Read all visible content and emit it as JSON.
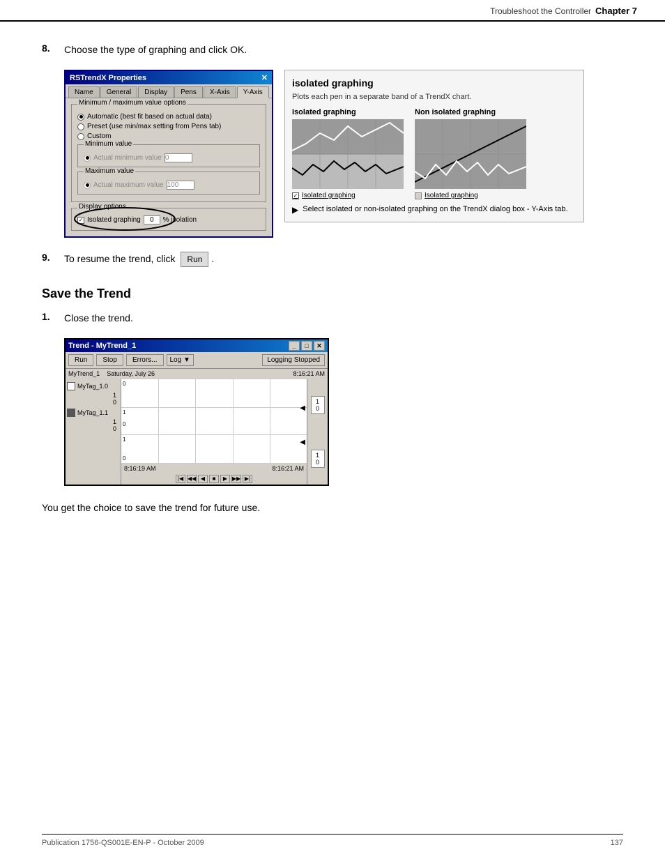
{
  "header": {
    "section": "Troubleshoot the Controller",
    "chapter": "Chapter 7"
  },
  "step8": {
    "number": "8.",
    "text": "Choose the type of graphing and click OK."
  },
  "step9": {
    "number": "9.",
    "text": "To resume the trend, click",
    "button_label": "Run",
    "period": "."
  },
  "dialog": {
    "title": "RSTrendX Properties",
    "tabs": [
      "Name",
      "General",
      "Display",
      "Pens",
      "X-Axis",
      "Y-Axis"
    ],
    "active_tab": "Y-Axis",
    "group_title": "Minimum / maximum value options",
    "radio1": "Automatic (best fit based on actual data)",
    "radio2": "Preset      (use min/max setting from Pens tab)",
    "radio3": "Custom",
    "min_group": "Minimum value",
    "actual_min_label": "Actual minimum value",
    "actual_min_value": "0",
    "max_group": "Maximum value",
    "actual_max_label": "Actual maximum value",
    "actual_max_value": "100",
    "display_options": "Display options",
    "isolated_checkbox": "Isolated graphing",
    "isolation_value": "0",
    "isolation_label": "% isolation"
  },
  "info_box": {
    "title": "isolated graphing",
    "description": "Plots each pen in a separate band of a TrendX chart.",
    "graph1_label": "Isolated graphing",
    "graph2_label": "Non isolated graphing",
    "graph1_caption": "Isolated graphing",
    "graph2_caption": "Isolated graphing",
    "arrow_text": "Select isolated or non-isolated graphing on the TrendX dialog box - Y-Axis tab."
  },
  "save_section": {
    "heading": "Save the Trend",
    "step1_number": "1.",
    "step1_text": "Close the trend."
  },
  "trend_window": {
    "title": "Trend - MyTrend_1",
    "controls": [
      "_",
      "□",
      "×"
    ],
    "toolbar": {
      "run": "Run",
      "stop": "Stop",
      "errors": "Errors...",
      "log": "Log ▼",
      "status": "Logging Stopped"
    },
    "header_row": {
      "tag_col": "",
      "trend_name": "MyTrend_1",
      "date": "Saturday, July 26",
      "time": "8:16:21 AM"
    },
    "tags": [
      {
        "name": "MyTag_1.0",
        "color": "#fff",
        "value1": "1",
        "value2": "0"
      },
      {
        "name": "MyTag_1.1",
        "color": "#888",
        "value1": "1",
        "value2": "0"
      }
    ],
    "timestamps": {
      "left": "8:16:19 AM",
      "right": "8:16:21 AM"
    }
  },
  "para_text": "You get the choice to save the trend for future use.",
  "footer": {
    "left": "Publication 1756-QS001E-EN-P - October 2009",
    "right": "137"
  }
}
